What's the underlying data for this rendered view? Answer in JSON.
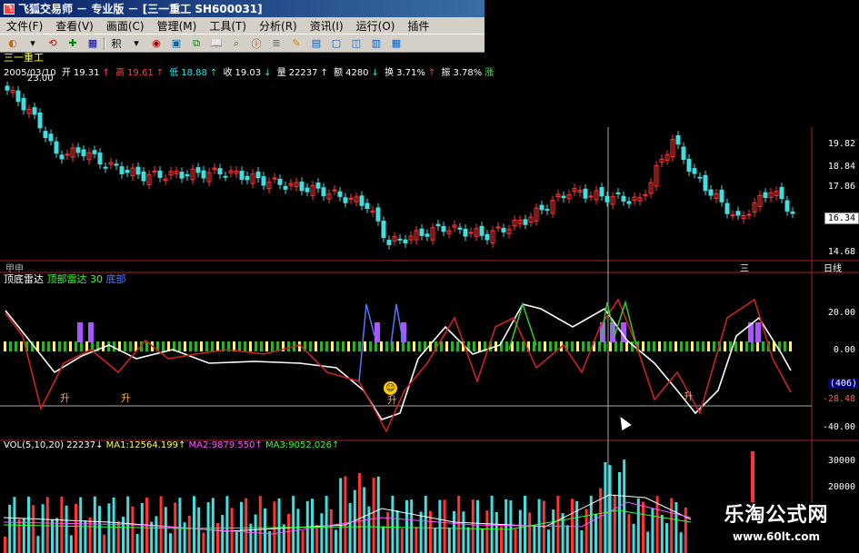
{
  "window": {
    "title": "飞狐交易师 － 专业版 － [三一重工  SH600031]",
    "icon": "app-icon"
  },
  "menu": [
    "文件(F)",
    "查看(V)",
    "画面(C)",
    "管理(M)",
    "工具(T)",
    "分析(R)",
    "资讯(I)",
    "运行(O)",
    "插件"
  ],
  "toolbar": {
    "icons": [
      "chart-icon",
      "dropdown-icon",
      "refresh-icon",
      "plus-icon",
      "grid-icon",
      "formula-icon",
      "dropdown-icon",
      "indicator-icon",
      "save-icon",
      "compare-icon",
      "book-icon",
      "search-icon",
      "info-icon",
      "news-icon",
      "pen-icon",
      "layout-icon",
      "window-icon",
      "window2-icon",
      "window3-icon",
      "window4-icon"
    ],
    "label_ji": "积"
  },
  "stock": {
    "name": "三一重工",
    "date": "2005/03/10",
    "open_label": "开",
    "open": "19.31",
    "high_label": "高",
    "high": "19.61",
    "low_label": "低",
    "low": "18.88",
    "close_label": "收",
    "close": "19.03",
    "vol_label": "量",
    "vol": "22237",
    "amt_label": "额",
    "amt": "4280",
    "turn_label": "换",
    "turn": "3.71%",
    "amp_label": "振",
    "amp": "3.78%",
    "extra": "涨",
    "peak_marker": "23.00"
  },
  "price_axis": [
    "19.82",
    "18.84",
    "17.86",
    "16.34",
    "14.68"
  ],
  "current_price": "16.34",
  "tabs": {
    "left": "甲申",
    "right_top": "三",
    "right_label": "日线"
  },
  "indicator": {
    "title": "顶底雷达",
    "param_label": "顶部雷达",
    "param_value": "30",
    "line2": "底部",
    "axis": [
      "20.00",
      "0.00",
      "-40.00"
    ],
    "current_a": "(406)",
    "current_b": "-28.48",
    "signal_text": "升"
  },
  "volume": {
    "label": "VOL(5,10,20)",
    "value": "22237",
    "ma1_label": "MA1:12564.199",
    "ma2_label": "MA2:9879.550",
    "ma3_label": "MA3:9052.026",
    "axis": [
      "30000",
      "20000"
    ]
  },
  "watermark": {
    "line1": "乐淘公式网",
    "line2": "www.60lt.com"
  },
  "colors": {
    "up": "#ff3333",
    "down": "#44dddd",
    "white_line": "#ffffff",
    "red_line": "#cc2222",
    "bar_green": "#33aa33",
    "bar_yellow": "#ffee88",
    "purple": "#aa55ff",
    "blue": "#5577ff"
  }
}
